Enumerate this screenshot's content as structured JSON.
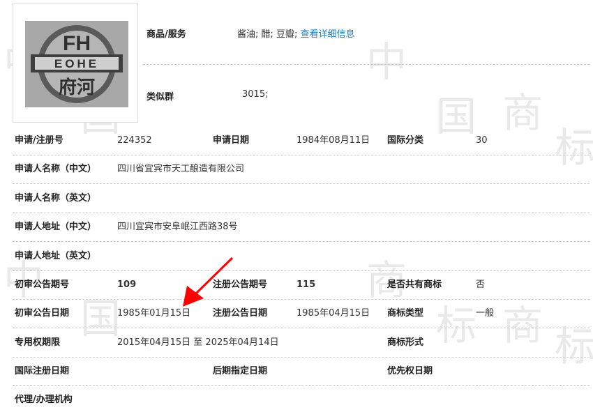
{
  "logo": {
    "text_top": "FH",
    "text_mid": "ЕОНЕ",
    "text_bottom": "府河"
  },
  "goods": {
    "label": "商品/服务",
    "value": "酱油; 醋; 豆瓣; ",
    "link": "查看详细信息"
  },
  "similar": {
    "label": "类似群",
    "value": "3015;"
  },
  "rows": {
    "r1": {
      "l1": "申请/注册号",
      "v1": "224352",
      "l2": "申请日期",
      "v2": "1984年08月11日",
      "l3": "国际分类",
      "v3": "30"
    },
    "r2": {
      "l1": "申请人名称（中文）",
      "v1": "四川省宜宾市天工酿造有限公司"
    },
    "r3": {
      "l1": "申请人名称（英文）"
    },
    "r4": {
      "l1": "申请人地址（中文）",
      "v1": "四川宜宾市安阜岷江西路38号"
    },
    "r5": {
      "l1": "申请人地址（英文）"
    },
    "r6": {
      "l1": "初审公告期号",
      "v1": "109",
      "l2": "注册公告期号",
      "v2": "115",
      "l3": "是否共有商标",
      "v3": "否"
    },
    "r7": {
      "l1": "初审公告日期",
      "v1": "1985年01月15日",
      "l2": "注册公告日期",
      "v2": "1985年04月15日",
      "l3": "商标类型",
      "v3": "一般"
    },
    "r8": {
      "l1": "专用权期限",
      "v1": "2015年04月15日 至 2025年04月14日",
      "l3": "商标形式"
    },
    "r9": {
      "l1": "国际注册日期",
      "l2": "后期指定日期",
      "l3": "优先权日期"
    },
    "r10": {
      "l1": "代理/办理机构"
    }
  },
  "watermark": [
    "中",
    "国",
    "商",
    "标",
    "中",
    "国",
    "商",
    "标",
    "中",
    "国",
    "商",
    "标"
  ],
  "colors": {
    "link": "#1a7fc4",
    "arrow": "#ff0000",
    "watermark": "#e9e9e9"
  }
}
